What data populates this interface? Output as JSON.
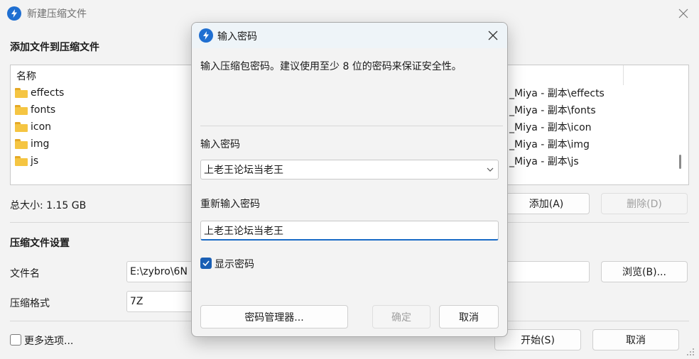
{
  "main_window": {
    "title": "新建压缩文件",
    "section_add": "添加文件到压缩文件",
    "list": {
      "header_name": "名称",
      "items": [
        {
          "name": "effects",
          "path": "_Miya - 副本\\effects"
        },
        {
          "name": "fonts",
          "path": "_Miya - 副本\\fonts"
        },
        {
          "name": "icon",
          "path": "_Miya - 副本\\icon"
        },
        {
          "name": "img",
          "path": "_Miya - 副本\\img"
        },
        {
          "name": "js",
          "path": "_Miya - 副本\\js"
        }
      ]
    },
    "total_size": "总大小: 1.15 GB",
    "add_button": "添加(A)",
    "delete_button": "删除(D)",
    "section_settings": "压缩文件设置",
    "filename_label": "文件名",
    "filename_value": "E:\\zybro\\6N",
    "browse_button": "浏览(B)...",
    "format_label": "压缩格式",
    "format_value": "7Z",
    "more_options": "更多选项...",
    "start_button": "开始(S)",
    "cancel_button": "取消"
  },
  "password_dialog": {
    "title": "输入密码",
    "description": "输入压缩包密码。建议使用至少 8 位的密码来保证安全性。",
    "password_label": "输入密码",
    "password_value": "上老王论坛当老王",
    "reenter_label": "重新输入密码",
    "reenter_value": "上老王论坛当老王",
    "show_password_label": "显示密码",
    "show_password_checked": true,
    "manager_button": "密码管理器...",
    "ok_button": "确定",
    "cancel_button": "取消"
  },
  "colors": {
    "accent": "#1a5fb4",
    "app_icon": "#1f6fd1",
    "folder": "#f5c542"
  },
  "icons": [
    "app-icon",
    "close-icon",
    "folder-icon",
    "chevron-down-icon",
    "checkmark-icon",
    "resize-grip-icon"
  ]
}
